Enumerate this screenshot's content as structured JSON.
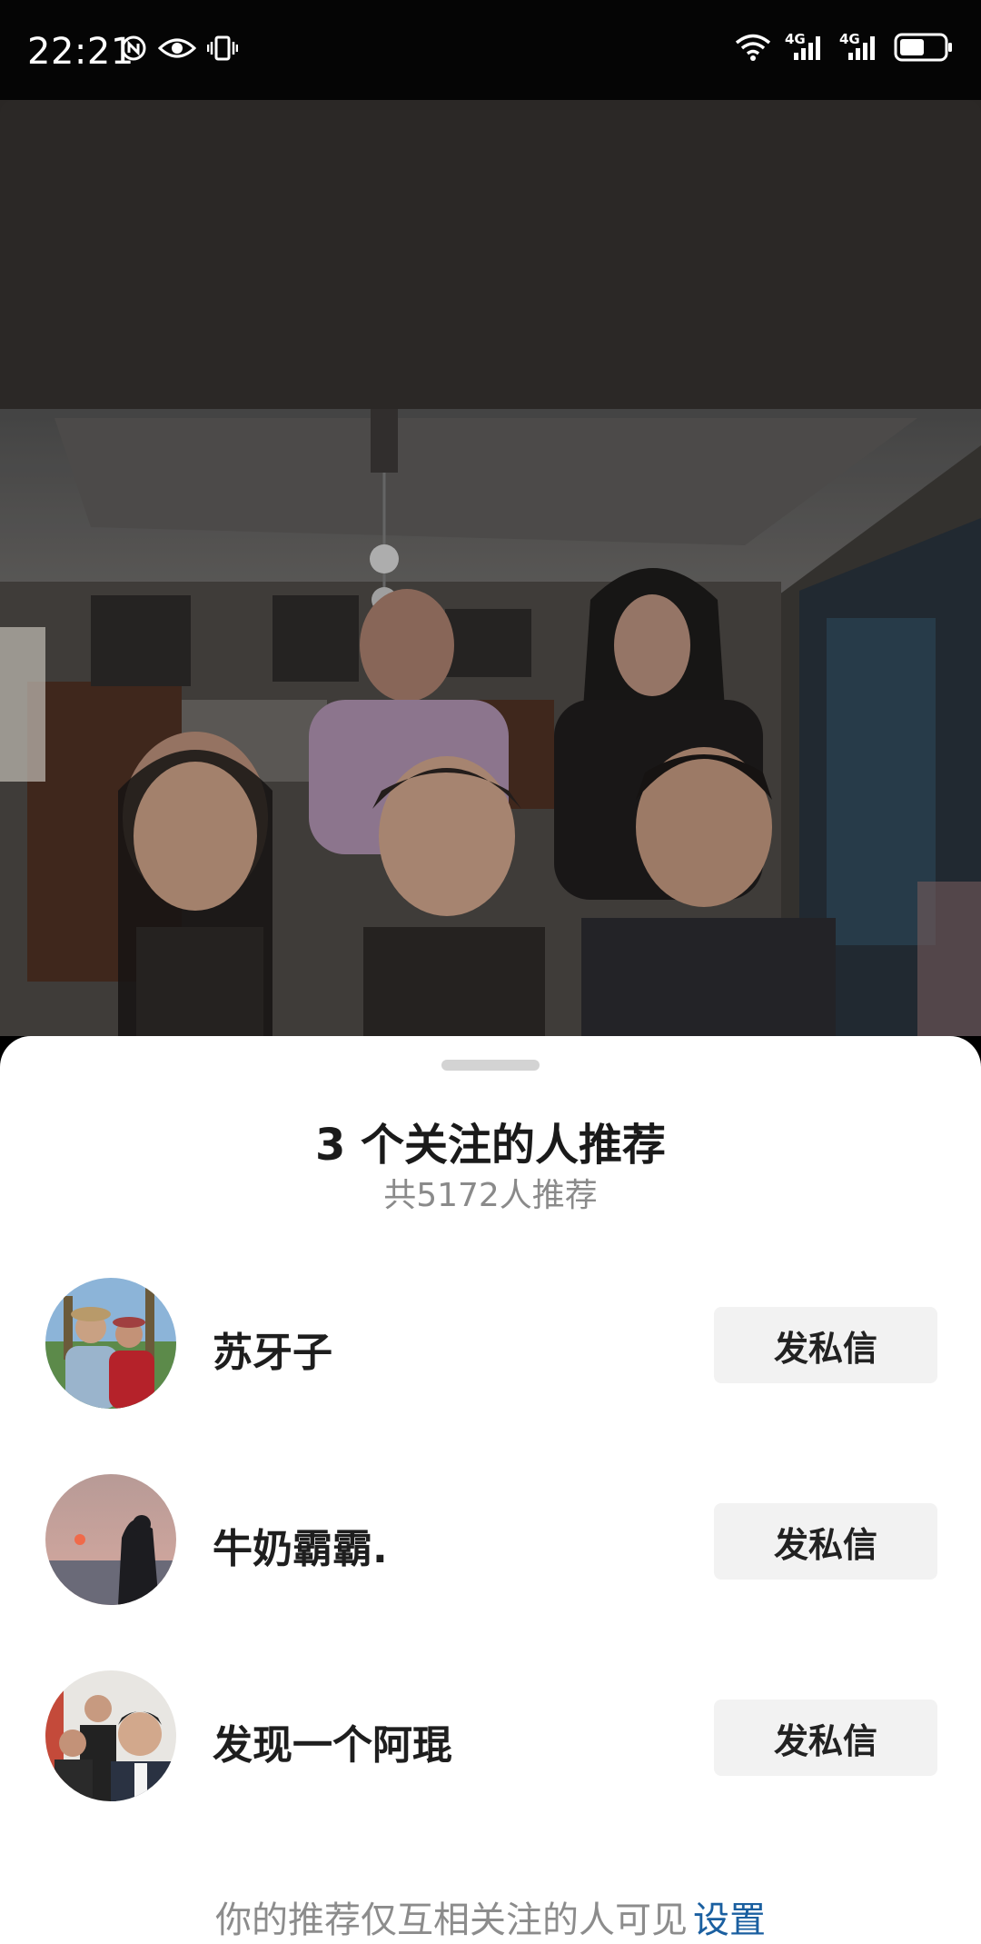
{
  "status_bar": {
    "time": "22:21",
    "left_icons": [
      "nfc-icon",
      "eye-icon",
      "vibrate-icon"
    ],
    "right_icons": [
      "wifi-icon",
      "signal-4g-icon",
      "signal-4g-icon",
      "battery-icon"
    ],
    "signal_label_1": "4G",
    "signal_label_2": "4G"
  },
  "media": {
    "background_color": "#2b2826"
  },
  "sheet": {
    "title": "3 个关注的人推荐",
    "subtitle": "共5172人推荐",
    "users": [
      {
        "name": "苏牙子",
        "button_label": "发私信"
      },
      {
        "name": "牛奶霸霸.",
        "button_label": "发私信"
      },
      {
        "name": "发现一个阿琨",
        "button_label": "发私信"
      }
    ],
    "footer_text": "你的推荐仅互相关注的人可见",
    "footer_link": "设置"
  },
  "colors": {
    "link": "#1a5fa0",
    "button_bg": "#f2f2f2",
    "subtitle": "#8a8a8a"
  }
}
